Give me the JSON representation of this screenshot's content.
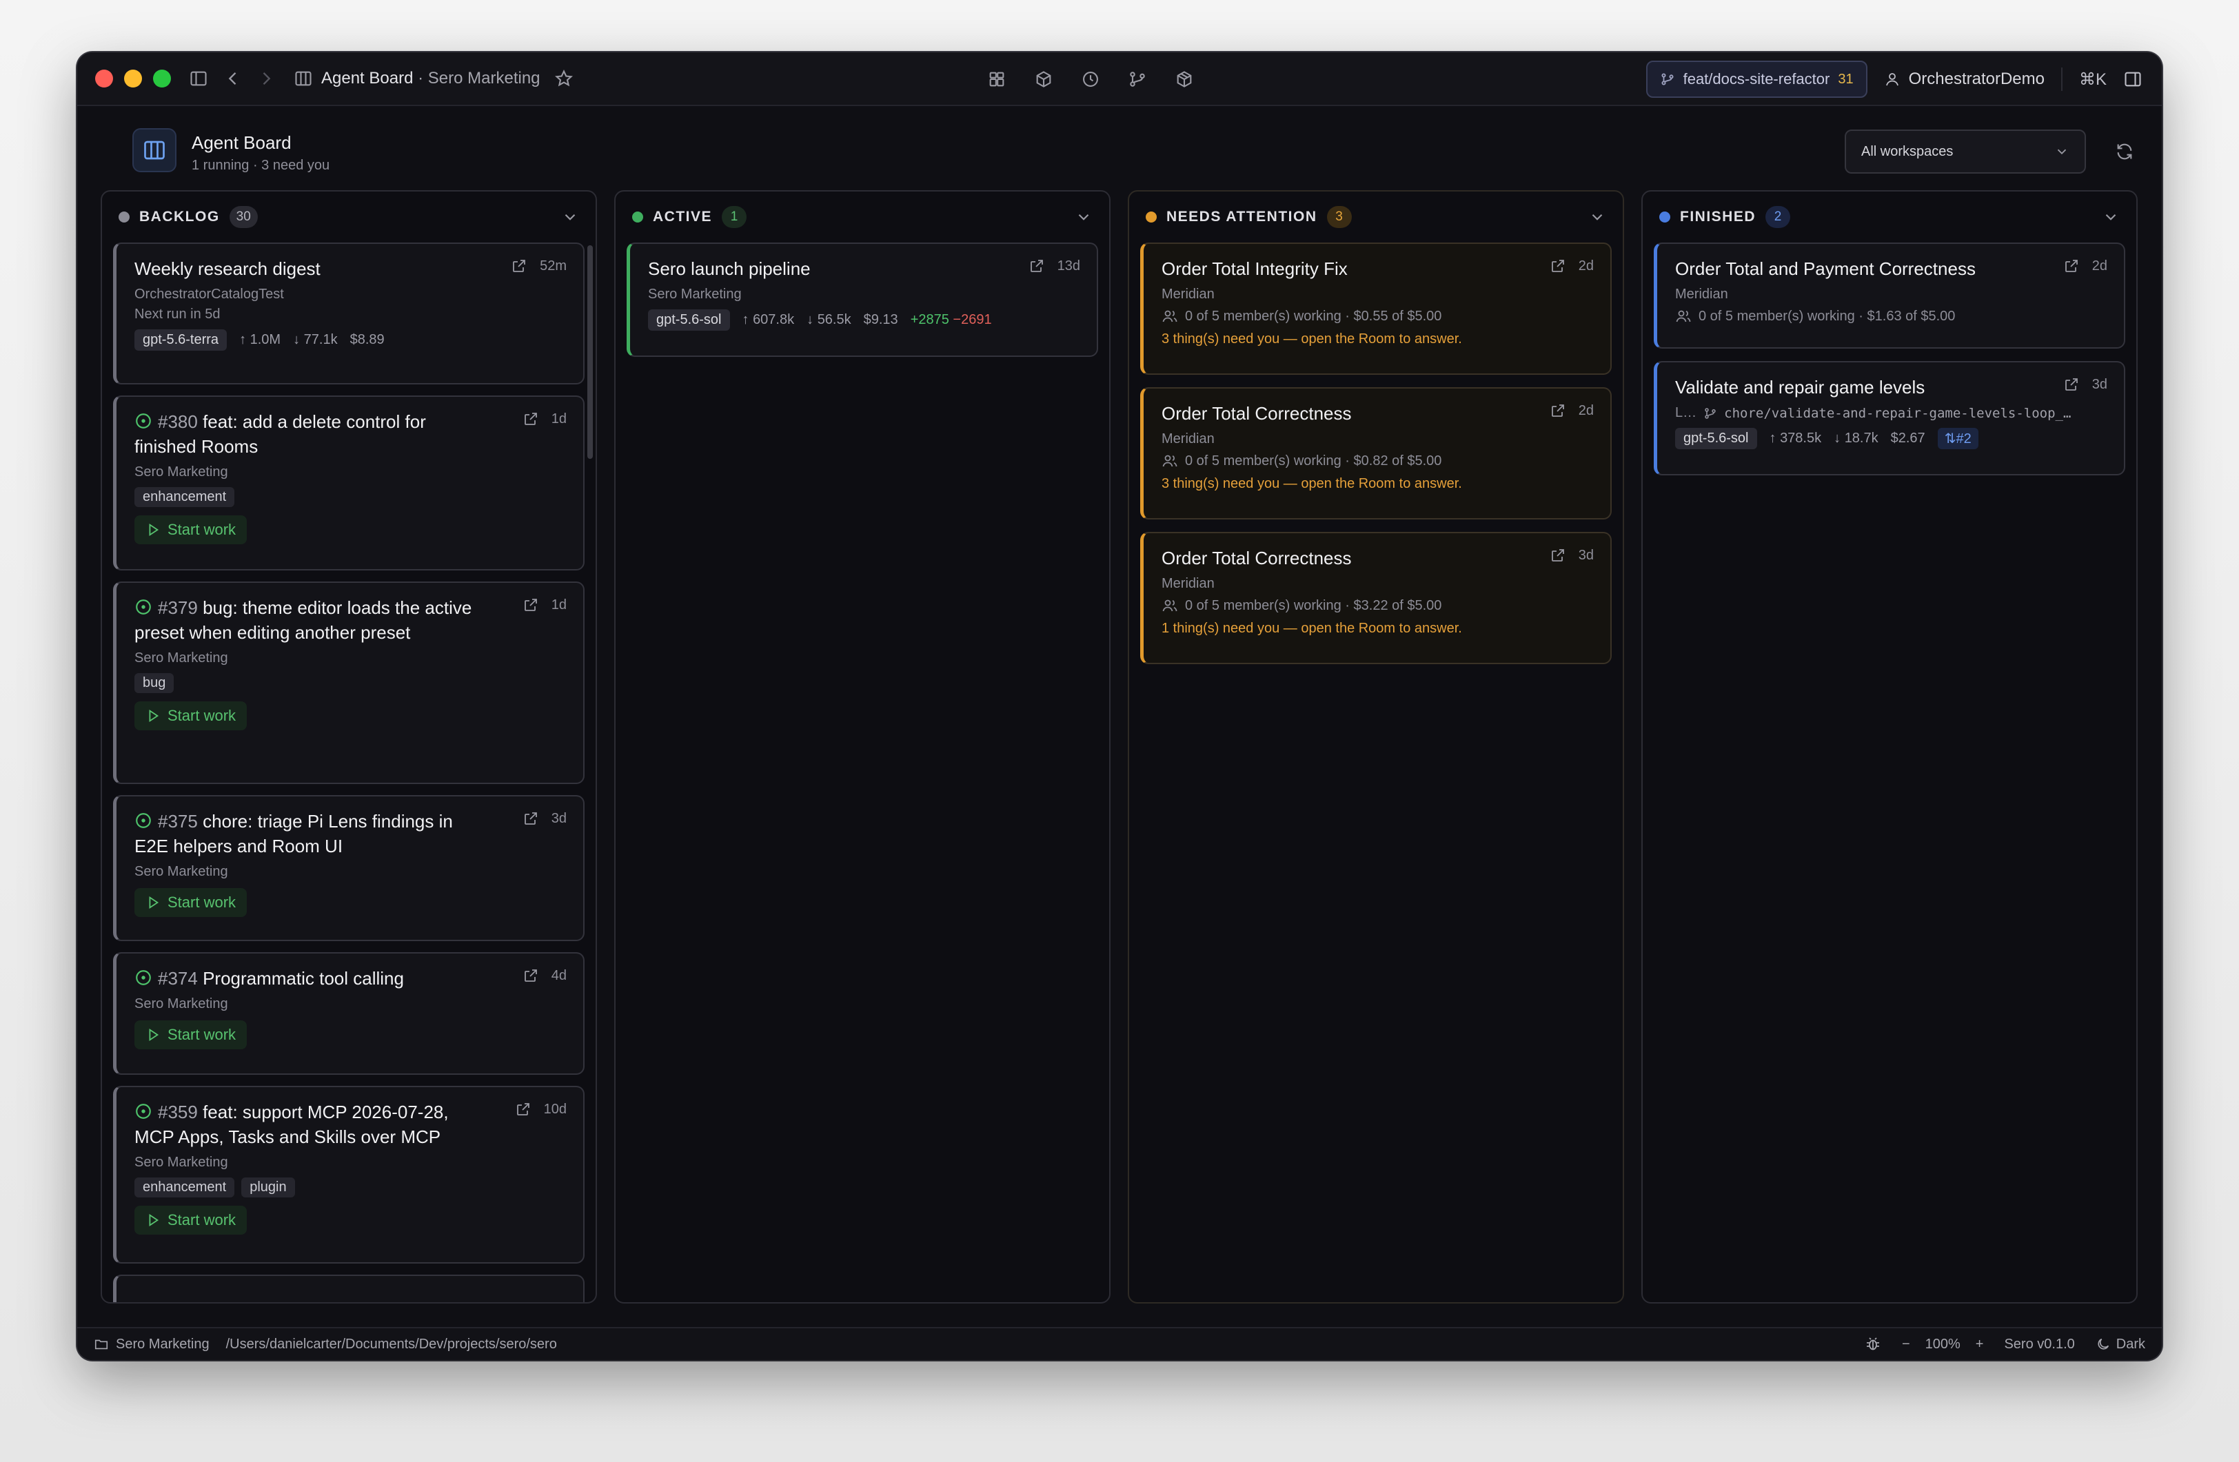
{
  "titlebar": {
    "title": "Agent Board",
    "subtitle": "· Sero Marketing",
    "branch": "feat/docs-site-refactor",
    "branch_count": "31",
    "user": "OrchestratorDemo",
    "shortcut": "⌘K"
  },
  "header": {
    "title": "Agent Board",
    "subtitle": "1 running · 3 need you",
    "workspace_select": "All workspaces"
  },
  "columns": {
    "backlog": {
      "label": "BACKLOG",
      "count": "30",
      "color": "#8b8b95"
    },
    "active": {
      "label": "ACTIVE",
      "count": "1",
      "color": "#3fae5f"
    },
    "attention": {
      "label": "NEEDS ATTENTION",
      "count": "3",
      "color": "#e19a2c"
    },
    "finished": {
      "label": "FINISHED",
      "count": "2",
      "color": "#4a7de0"
    }
  },
  "backlog": {
    "c0": {
      "title": "Weekly research digest",
      "age": "52m",
      "sub": "OrchestratorCatalogTest",
      "next": "Next run in 5d",
      "model": "gpt-5.6-terra",
      "up": "1.0M",
      "down": "77.1k",
      "cost": "$8.89"
    },
    "c1": {
      "num": "#380",
      "title": "feat: add a delete control for finished Rooms",
      "age": "1d",
      "project": "Sero Marketing",
      "tag1": "enhancement",
      "action": "Start work"
    },
    "c2": {
      "num": "#379",
      "title": "bug: theme editor loads the active preset when editing another preset",
      "age": "1d",
      "project": "Sero Marketing",
      "tag1": "bug",
      "action": "Start work"
    },
    "c3": {
      "num": "#375",
      "title": "chore: triage Pi Lens findings in E2E helpers and Room UI",
      "age": "3d",
      "project": "Sero Marketing",
      "action": "Start work"
    },
    "c4": {
      "num": "#374",
      "title": "Programmatic tool calling",
      "age": "4d",
      "project": "Sero Marketing",
      "action": "Start work"
    },
    "c5": {
      "num": "#359",
      "title": "feat: support MCP 2026-07-28, MCP Apps, Tasks and Skills over MCP",
      "age": "10d",
      "project": "Sero Marketing",
      "tag1": "enhancement",
      "tag2": "plugin",
      "action": "Start work"
    }
  },
  "active": {
    "c0": {
      "title": "Sero launch pipeline",
      "age": "13d",
      "project": "Sero Marketing",
      "model": "gpt-5.6-sol",
      "up": "607.8k",
      "down": "56.5k",
      "cost": "$9.13",
      "added": "+2875",
      "removed": "−2691"
    }
  },
  "attention": {
    "c0": {
      "title": "Order Total Integrity Fix",
      "age": "2d",
      "project": "Meridian",
      "members": "0 of 5 member(s) working · $0.55 of $5.00",
      "warn": "3 thing(s) need you — open the Room to answer."
    },
    "c1": {
      "title": "Order Total Correctness",
      "age": "2d",
      "project": "Meridian",
      "members": "0 of 5 member(s) working · $0.82 of $5.00",
      "warn": "3 thing(s) need you — open the Room to answer."
    },
    "c2": {
      "title": "Order Total Correctness",
      "age": "3d",
      "project": "Meridian",
      "members": "0 of 5 member(s) working · $3.22 of $5.00",
      "warn": "1 thing(s) need you — open the Room to answer."
    }
  },
  "finished": {
    "c0": {
      "title": "Order Total and Payment Correctness",
      "age": "2d",
      "project": "Meridian",
      "members": "0 of 5 member(s) working · $1.63 of $5.00"
    },
    "c1": {
      "title": "Validate and repair game levels",
      "age": "3d",
      "project_short": "L…",
      "branch": "chore/validate-and-repair-game-levels-loop_…",
      "model": "gpt-5.6-sol",
      "up": "378.5k",
      "down": "18.7k",
      "cost": "$2.67",
      "pr": "#2"
    }
  },
  "statusbar": {
    "workspace": "Sero Marketing",
    "path": "/Users/danielcarter/Documents/Dev/projects/sero/sero",
    "zoom_minus": "−",
    "zoom": "100%",
    "zoom_plus": "+",
    "version": "Sero v0.1.0",
    "theme": "Dark"
  }
}
